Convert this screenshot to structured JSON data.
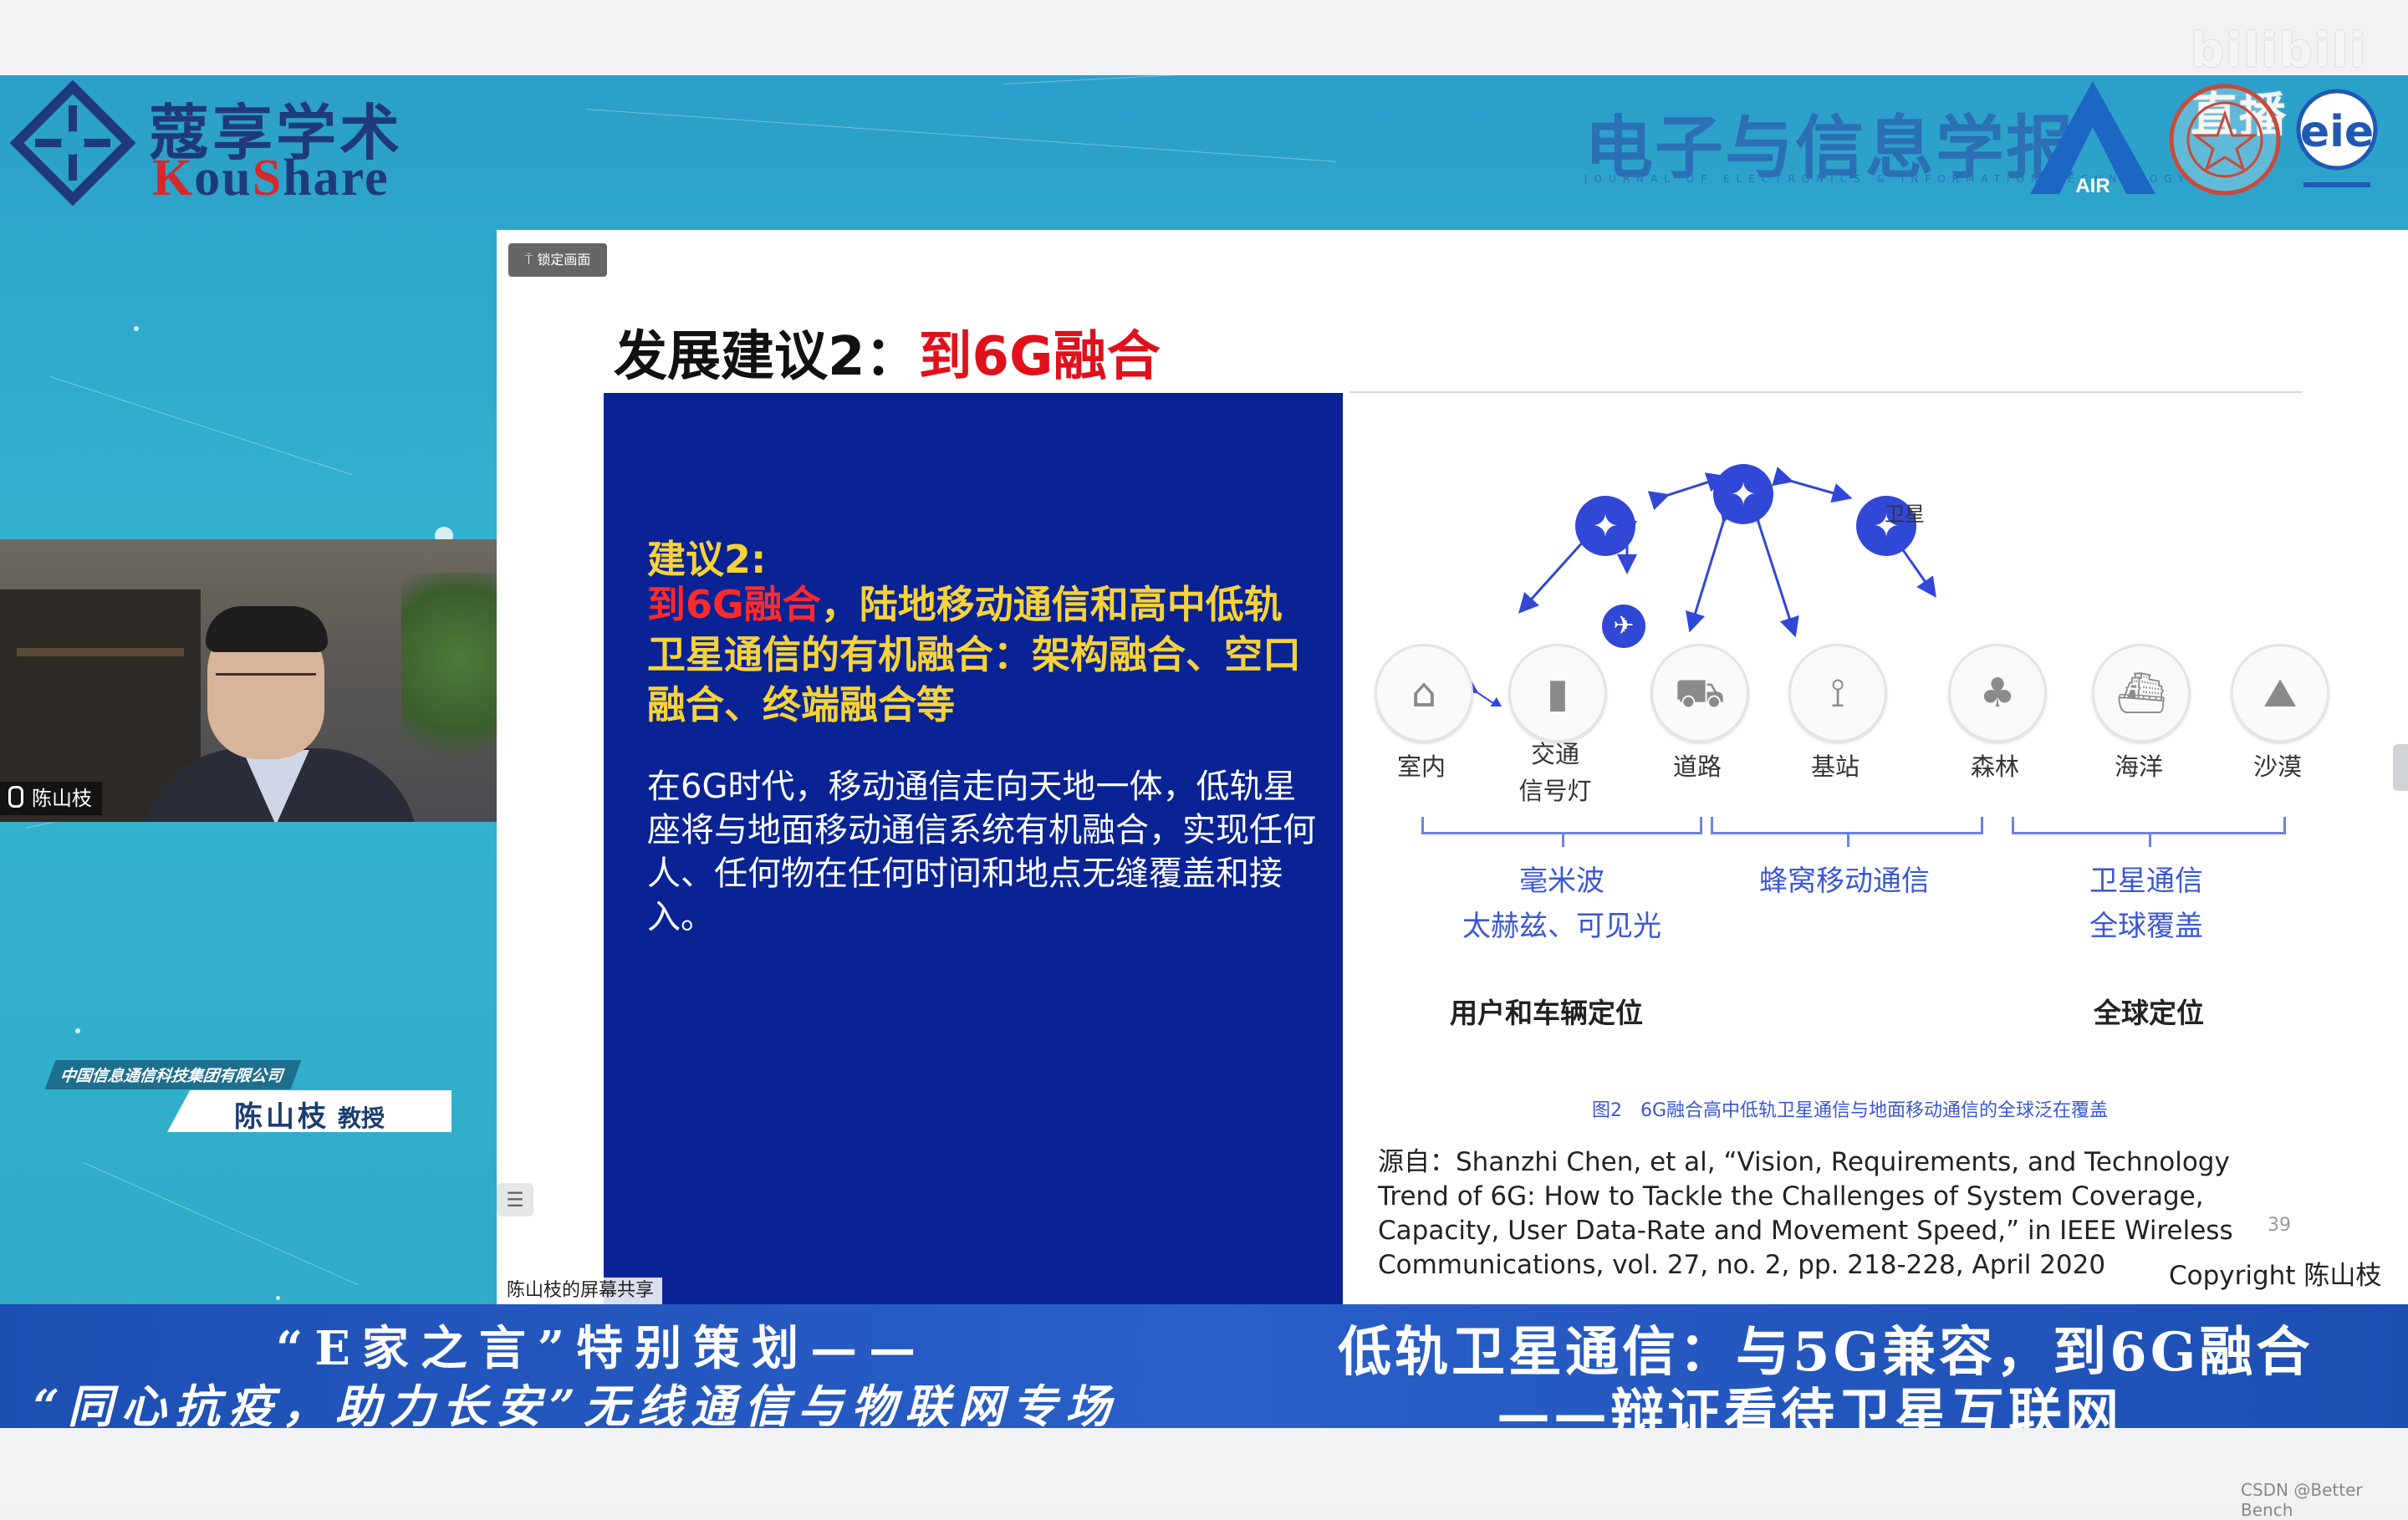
{
  "watermark": "bilibili 直播",
  "header": {
    "logo_cn": "蔻享学术",
    "logo_en_k": "K",
    "logo_en_ou": "ou",
    "logo_en_s": "S",
    "logo_en_hare": "hare",
    "journal_title": "电子与信息学报",
    "journal_subtitle": "JOURNAL OF ELECTRONICS & INFORMATION TECHNOLOGY",
    "air_label": "AIR"
  },
  "video": {
    "name": "陈山枝"
  },
  "name_tag": {
    "company": "中国信息通信科技集团有限公司",
    "name": "陈山枝",
    "title": "教授"
  },
  "slide": {
    "pin_button": "锁定画面",
    "title_prefix": "发展建议2：",
    "title_red": "到6G融合",
    "label": "建议2:",
    "head_red": "到6G融合",
    "head_rest": "，陆地移动通信和高中低轨卫星通信的有机融合：架构融合、空口融合、终端融合等",
    "body": "在6G时代，移动通信走向天地一体，低轨星座将与地面移动通信系统有机融合，实现任何人、任何物在任何时间和地点无缝覆盖和接入。",
    "diagram": {
      "sat_label": "卫星",
      "categories": [
        "室内",
        "交通\n信号灯",
        "道路",
        "基站",
        "森林",
        "海洋",
        "沙漠"
      ],
      "tech1_line1": "毫米波",
      "tech1_line2": "太赫兹、可见光",
      "tech2": "蜂窝移动通信",
      "tech3_line1": "卫星通信",
      "tech3_line2": "全球覆盖",
      "loc1": "用户和车辆定位",
      "loc2": "全球定位"
    },
    "figure_caption": "图2　6G融合高中低轨卫星通信与地面移动通信的全球泛在覆盖",
    "source": "源自：Shanzhi Chen, et al, “Vision, Requirements, and Technology Trend of 6G: How to Tackle the Challenges of System Coverage, Capacity, User Data-Rate and Movement Speed,” in IEEE Wireless Communications, vol. 27, no. 2, pp. 218-228, April 2020",
    "page_number": "39",
    "copyright": "Copyright 陈山枝"
  },
  "share_label": "陈山枝的屏幕共享",
  "banner": {
    "left_line1": "“E家之言”特别策划——",
    "left_line2": "“同心抗疫，助力长安”无线通信与物联网专场",
    "right_line1": "低轨卫星通信：与5G兼容，到6G融合",
    "right_line2": "——辩证看待卫星互联网"
  },
  "footer_credit": "CSDN @Better Bench",
  "colors": {
    "slide_blue": "#0a2394",
    "accent_yellow": "#f5d23b",
    "accent_red": "#e0111b",
    "banner_blue": "#1d4fb3"
  }
}
